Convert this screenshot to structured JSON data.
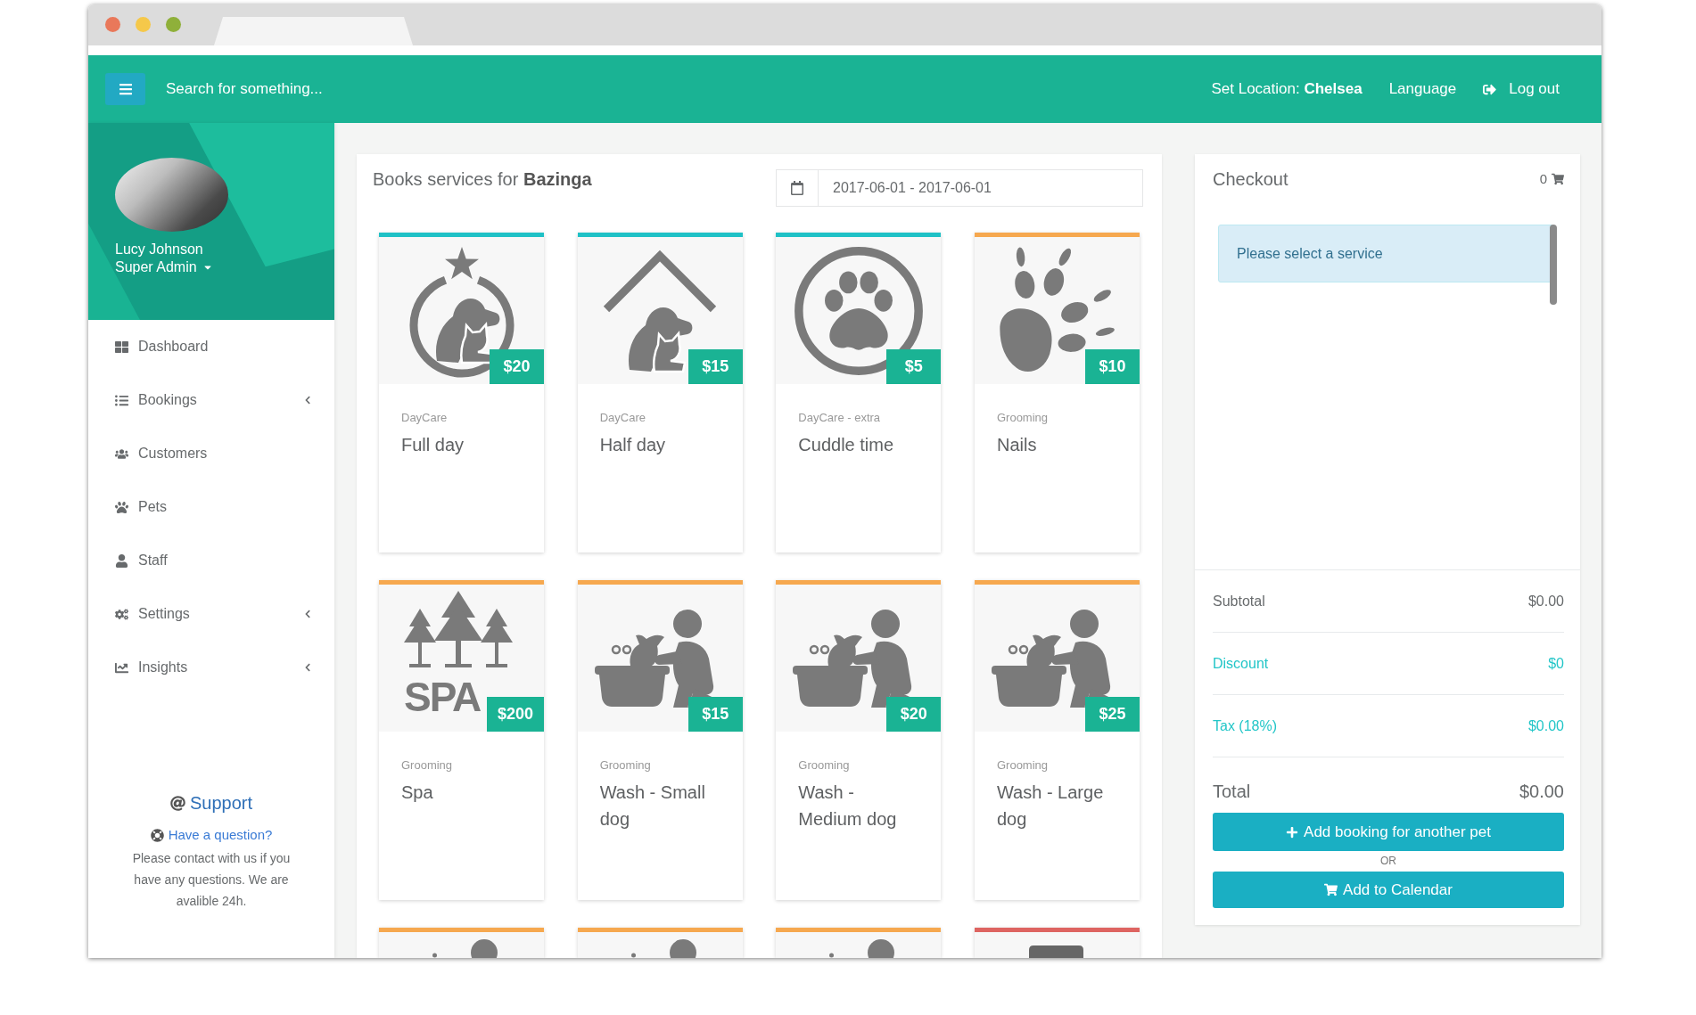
{
  "topbar": {
    "search_placeholder": "Search for something...",
    "location": "Set Location: **Chelsea**",
    "language": "Language",
    "logout": "Log out"
  },
  "profile": {
    "name": "Lucy Johnson",
    "role": "Super Admin"
  },
  "sidebar": {
    "items": [
      {
        "label": "Dashboard",
        "kind": "link"
      },
      {
        "label": "Bookings",
        "kind": "submenu"
      },
      {
        "label": "Customers",
        "kind": "link"
      },
      {
        "label": "Pets",
        "kind": "link"
      },
      {
        "label": "Staff",
        "kind": "link"
      },
      {
        "label": "Settings",
        "kind": "submenu"
      },
      {
        "label": "Insights",
        "kind": "submenu"
      }
    ]
  },
  "support": {
    "title": "Support",
    "link": "Have a question?",
    "text": "Please contact with us if you have any questions. We are avalible 24h."
  },
  "services_panel": {
    "title": "Books services for **Bazinga**",
    "date_range": "2017-06-01 - 2017-06-01"
  },
  "services": [
    {
      "kind": "ring",
      "color": "#1fc1c6",
      "price": "$20",
      "category": "DayCare",
      "name": "Full day"
    },
    {
      "kind": "roof",
      "color": "#1fc1c6",
      "price": "$15",
      "category": "DayCare",
      "name": "Half day"
    },
    {
      "kind": "paw",
      "color": "#1fc1c6",
      "price": "$5",
      "category": "DayCare - extra",
      "name": "Cuddle time"
    },
    {
      "kind": "claw",
      "color": "#f6a84f",
      "price": "$10",
      "category": "Grooming",
      "name": "Nails"
    },
    {
      "kind": "spa",
      "color": "#f6a84f",
      "price": "$200",
      "category": "Grooming",
      "name": "Spa",
      "icon_text": "SPA"
    },
    {
      "kind": "bath",
      "color": "#f6a84f",
      "price": "$15",
      "category": "Grooming",
      "name": "Wash - Small dog"
    },
    {
      "kind": "bath",
      "color": "#f6a84f",
      "price": "$20",
      "category": "Grooming",
      "name": "Wash - Medium dog"
    },
    {
      "kind": "bath",
      "color": "#f6a84f",
      "price": "$25",
      "category": "Grooming",
      "name": "Wash - Large dog"
    },
    {
      "kind": "walker",
      "color": "#f6a84f"
    },
    {
      "kind": "walker",
      "color": "#f6a84f"
    },
    {
      "kind": "walker",
      "color": "#f6a84f"
    },
    {
      "kind": "taxi",
      "color": "#de6461"
    }
  ],
  "checkout": {
    "title": "Checkout",
    "count": "0",
    "message": "Please select a service",
    "summary": [
      {
        "label": "Subtotal",
        "value": "$0.00",
        "kind": "plain"
      },
      {
        "label": "Discount",
        "value": "$0",
        "kind": "accent"
      },
      {
        "label": "Tax (18%)",
        "value": "$0.00",
        "kind": "accent"
      }
    ],
    "total": {
      "label": "Total",
      "value": "$0.00"
    },
    "add_pet_button": "Add booking for another pet",
    "separator": "OR",
    "calendar_button": "Add to Calendar"
  }
}
